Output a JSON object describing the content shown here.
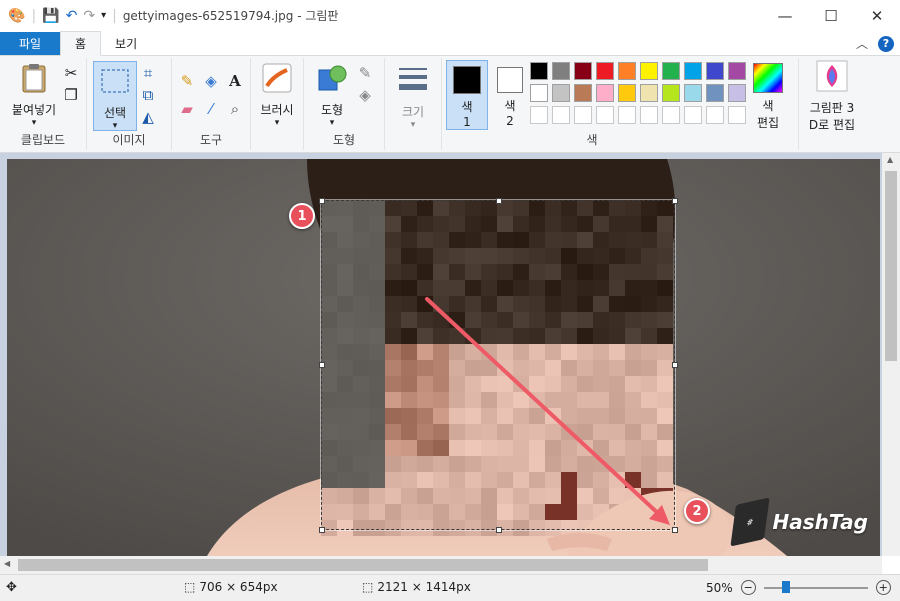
{
  "window": {
    "title": "gettyimages-652519794.jpg - 그림판",
    "min": "—",
    "max": "☐",
    "close": "✕"
  },
  "tabs": [
    {
      "label": "파일"
    },
    {
      "label": "홈"
    },
    {
      "label": "보기"
    }
  ],
  "ribbon": {
    "clipboard": {
      "paste": "붙여넣기",
      "label": "클립보드"
    },
    "image": {
      "select": "선택",
      "label": "이미지"
    },
    "tools": {
      "label": "도구"
    },
    "brushes": {
      "label": "브러시"
    },
    "shapes": {
      "shapes": "도형",
      "label": "도형"
    },
    "size": {
      "label": "크기"
    },
    "color1": {
      "label": "색",
      "num": "1"
    },
    "color2": {
      "label": "색",
      "num": "2"
    },
    "colors_label": "색",
    "edit_colors": {
      "line1": "색",
      "line2": "편집"
    },
    "paint3d": {
      "line1": "그림판 3",
      "line2": "D로 편집"
    }
  },
  "palette": {
    "row1": [
      "#000000",
      "#7f7f7f",
      "#880015",
      "#ed1c24",
      "#ff7f27",
      "#fff200",
      "#22b14c",
      "#00a2e8",
      "#3f48cc",
      "#a349a4"
    ],
    "row2": [
      "#ffffff",
      "#c3c3c3",
      "#b97a57",
      "#ffaec9",
      "#ffc90e",
      "#efe4b0",
      "#b5e61d",
      "#99d9ea",
      "#7092be",
      "#c8bfe7"
    ]
  },
  "status": {
    "selection_size": "706 × 654px",
    "image_size": "2121 × 1414px",
    "zoom": "50%"
  },
  "annotations": {
    "step1": "1",
    "step2": "2"
  },
  "watermark": {
    "text": "HashTag"
  }
}
